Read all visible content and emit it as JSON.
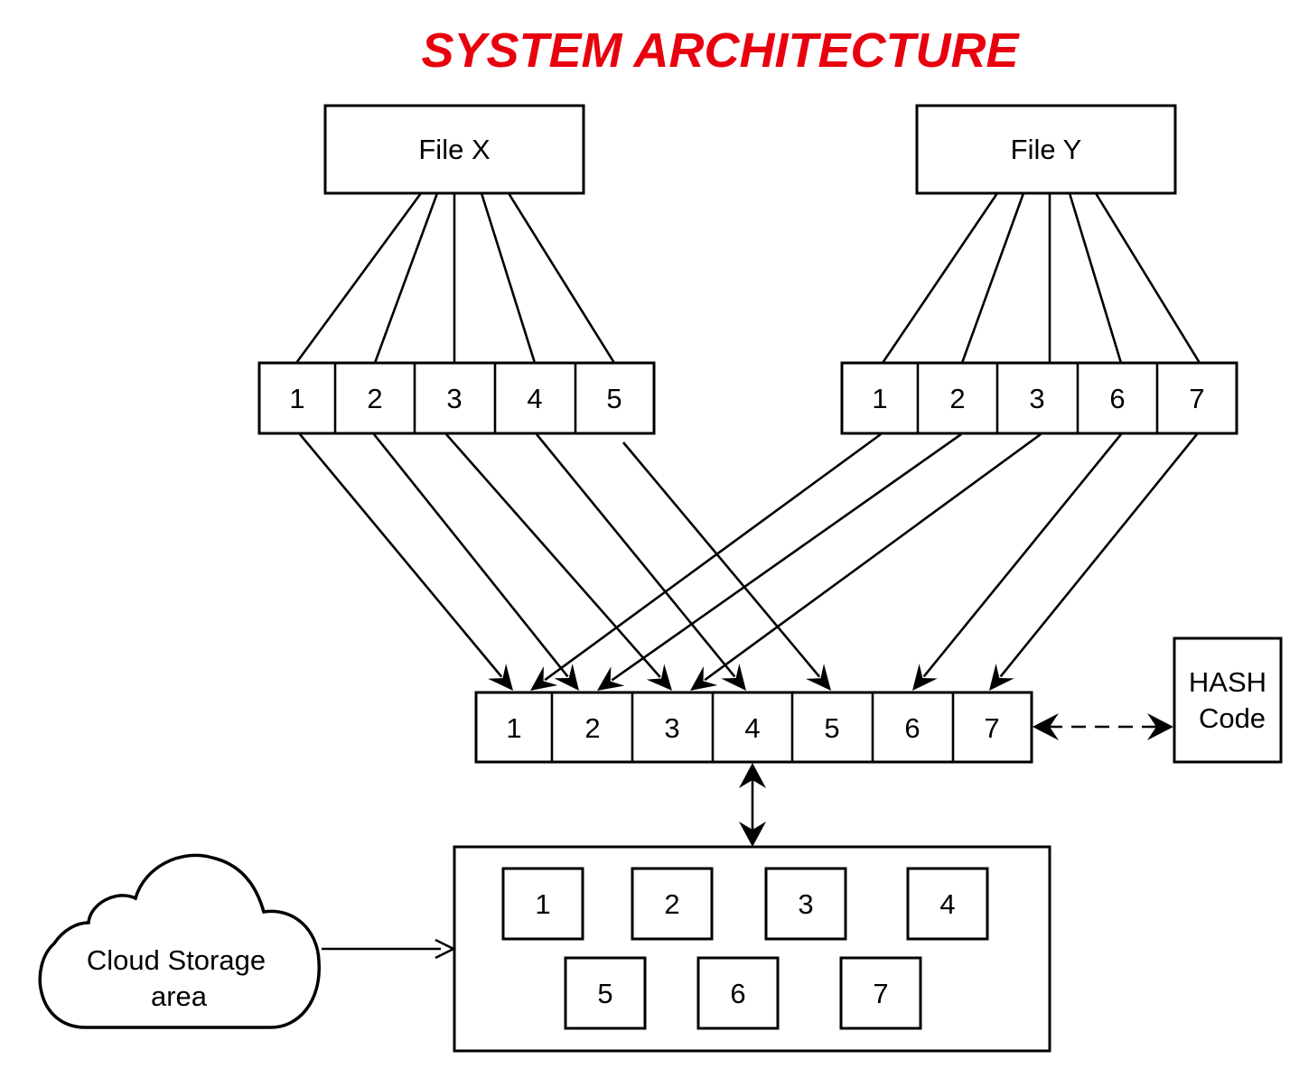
{
  "title": "SYSTEM ARCHITECTURE",
  "colors": {
    "title": "#e8000e",
    "stroke": "#000000",
    "background": "#ffffff"
  },
  "files": [
    {
      "id": "file-x",
      "label": "File X",
      "chunks": [
        "1",
        "2",
        "3",
        "4",
        "5"
      ]
    },
    {
      "id": "file-y",
      "label": "File Y",
      "chunks": [
        "1",
        "2",
        "3",
        "6",
        "7"
      ]
    }
  ],
  "merged_chunks": [
    "1",
    "2",
    "3",
    "4",
    "5",
    "6",
    "7"
  ],
  "hash": {
    "line1": "HASH",
    "line2": "Code"
  },
  "storage_blocks": [
    "1",
    "2",
    "3",
    "4",
    "5",
    "6",
    "7"
  ],
  "cloud": {
    "line1": "Cloud Storage",
    "line2": "area"
  },
  "connections": {
    "file_x_to_merged": [
      [
        "1",
        "1"
      ],
      [
        "2",
        "2"
      ],
      [
        "3",
        "3"
      ],
      [
        "4",
        "4"
      ],
      [
        "5",
        "5"
      ]
    ],
    "file_y_to_merged": [
      [
        "1",
        "1"
      ],
      [
        "2",
        "2"
      ],
      [
        "3",
        "3"
      ],
      [
        "6",
        "6"
      ],
      [
        "7",
        "7"
      ]
    ],
    "merged_to_hash": "bidirectional-dashed",
    "merged_to_storage": "bidirectional",
    "cloud_to_storage": "directed"
  }
}
